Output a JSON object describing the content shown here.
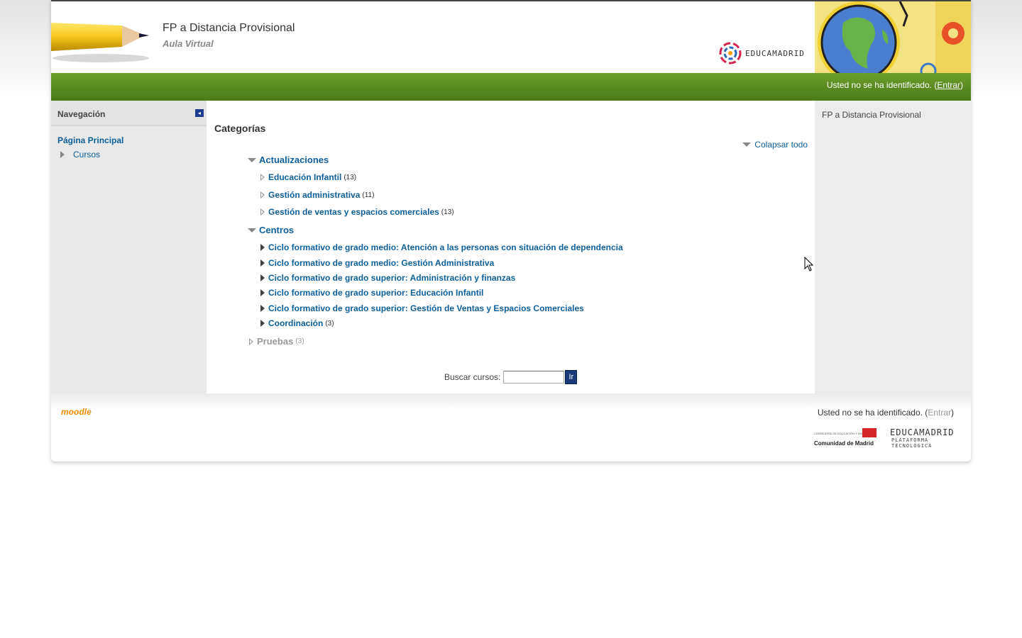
{
  "header": {
    "site_title": "FP a Distancia Provisional",
    "site_subtitle": "Aula Virtual",
    "educa_logo_text": "EDUCAMADRID",
    "login_prefix": "Usted no se ha identificado. (",
    "login_link": "Entrar",
    "login_suffix": ")"
  },
  "navigation": {
    "title": "Navegación",
    "home": "Página Principal",
    "courses": "Cursos",
    "icons": [
      "dock-icon",
      "expand-arrow-icon"
    ]
  },
  "main": {
    "heading": "Categorías",
    "collapse_all": "Colapsar todo",
    "categories": [
      {
        "name": "Actualizaciones",
        "expanded": true,
        "children": [
          {
            "name": "Educación Infantil",
            "count": "(13)"
          },
          {
            "name": "Gestión administrativa",
            "count": "(11)"
          },
          {
            "name": "Gestión de ventas y espacios comerciales",
            "count": "(13)"
          }
        ]
      },
      {
        "name": "Centros",
        "expanded": true,
        "children": [
          {
            "name": "Ciclo formativo de grado medio: Atención a las personas con situación de dependencia",
            "count": ""
          },
          {
            "name": "Ciclo formativo de grado medio: Gestión Administrativa",
            "count": ""
          },
          {
            "name": "Ciclo formativo de grado superior: Administración y finanzas",
            "count": ""
          },
          {
            "name": "Ciclo formativo de grado superior: Educación Infantil",
            "count": ""
          },
          {
            "name": "Ciclo formativo de grado superior: Gestión de Ventas y Espacios Comerciales",
            "count": ""
          },
          {
            "name": "Coordinación",
            "count": "(3)"
          }
        ]
      },
      {
        "name": "Pruebas",
        "expanded": false,
        "count": "(3)"
      }
    ],
    "search_label": "Buscar cursos:",
    "search_value": "",
    "search_button": "Ir"
  },
  "right_block": {
    "text": "FP a Distancia Provisional"
  },
  "footer": {
    "moodle": "moodle",
    "login_prefix": "Usted no se ha identificado. (",
    "login_link": "Entrar",
    "login_suffix": ")",
    "cam_small": "CONSEJERÍA DE EDUCACIÓN Y EMPLEO",
    "cam_name": "Comunidad de Madrid",
    "educa_title": "EDUCAMADRID",
    "educa_sub": "PLATAFORMA TECNOLÓGICA"
  },
  "colors": {
    "green_bar": "#5a8c22",
    "link": "#0d5f9a",
    "sidebar_bg": "#e9e9e9"
  }
}
